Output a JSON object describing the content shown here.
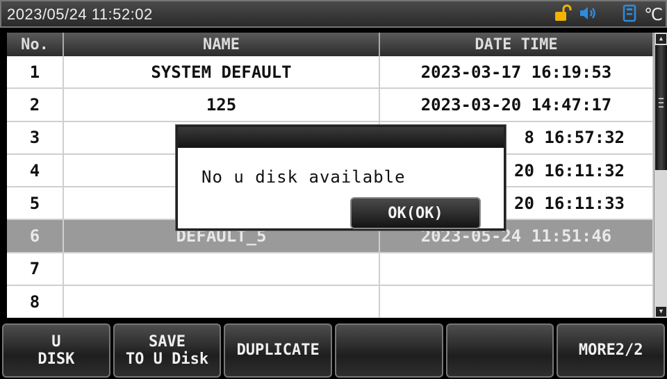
{
  "status_bar": {
    "datetime": "2023/05/24  11:52:02",
    "icons": [
      "unlock-icon",
      "speaker-icon",
      "usb-device-icon",
      "celsius-icon"
    ],
    "celsius_label": "℃",
    "colors": {
      "unlock": "#f2b400",
      "speaker": "#2a8de0",
      "usb": "#2a8de0"
    }
  },
  "table": {
    "headers": {
      "no": "No.",
      "name": "NAME",
      "datetime": "DATE TIME"
    },
    "rows": [
      {
        "no": "1",
        "name": "SYSTEM DEFAULT",
        "datetime": "2023-03-17 16:19:53"
      },
      {
        "no": "2",
        "name": "125",
        "datetime": "2023-03-20 14:47:17"
      },
      {
        "no": "3",
        "name": "",
        "datetime": "8 16:57:32"
      },
      {
        "no": "4",
        "name": "",
        "datetime": "20 16:11:32"
      },
      {
        "no": "5",
        "name": "",
        "datetime": "20 16:11:33"
      },
      {
        "no": "6",
        "name": "DEFAULT_5",
        "datetime": "2023-05-24 11:51:46",
        "selected": true
      },
      {
        "no": "7",
        "name": "",
        "datetime": ""
      },
      {
        "no": "8",
        "name": "",
        "datetime": ""
      }
    ]
  },
  "dialog": {
    "message": "No u disk available",
    "ok_label": "OK(OK)"
  },
  "softkeys": [
    {
      "line1": "U",
      "line2": "DISK"
    },
    {
      "line1": "SAVE",
      "line2": "TO U Disk"
    },
    {
      "line1": "DUPLICATE",
      "line2": ""
    },
    {
      "line1": "",
      "line2": ""
    },
    {
      "line1": "",
      "line2": ""
    },
    {
      "line1": "MORE2/2",
      "line2": ""
    }
  ]
}
